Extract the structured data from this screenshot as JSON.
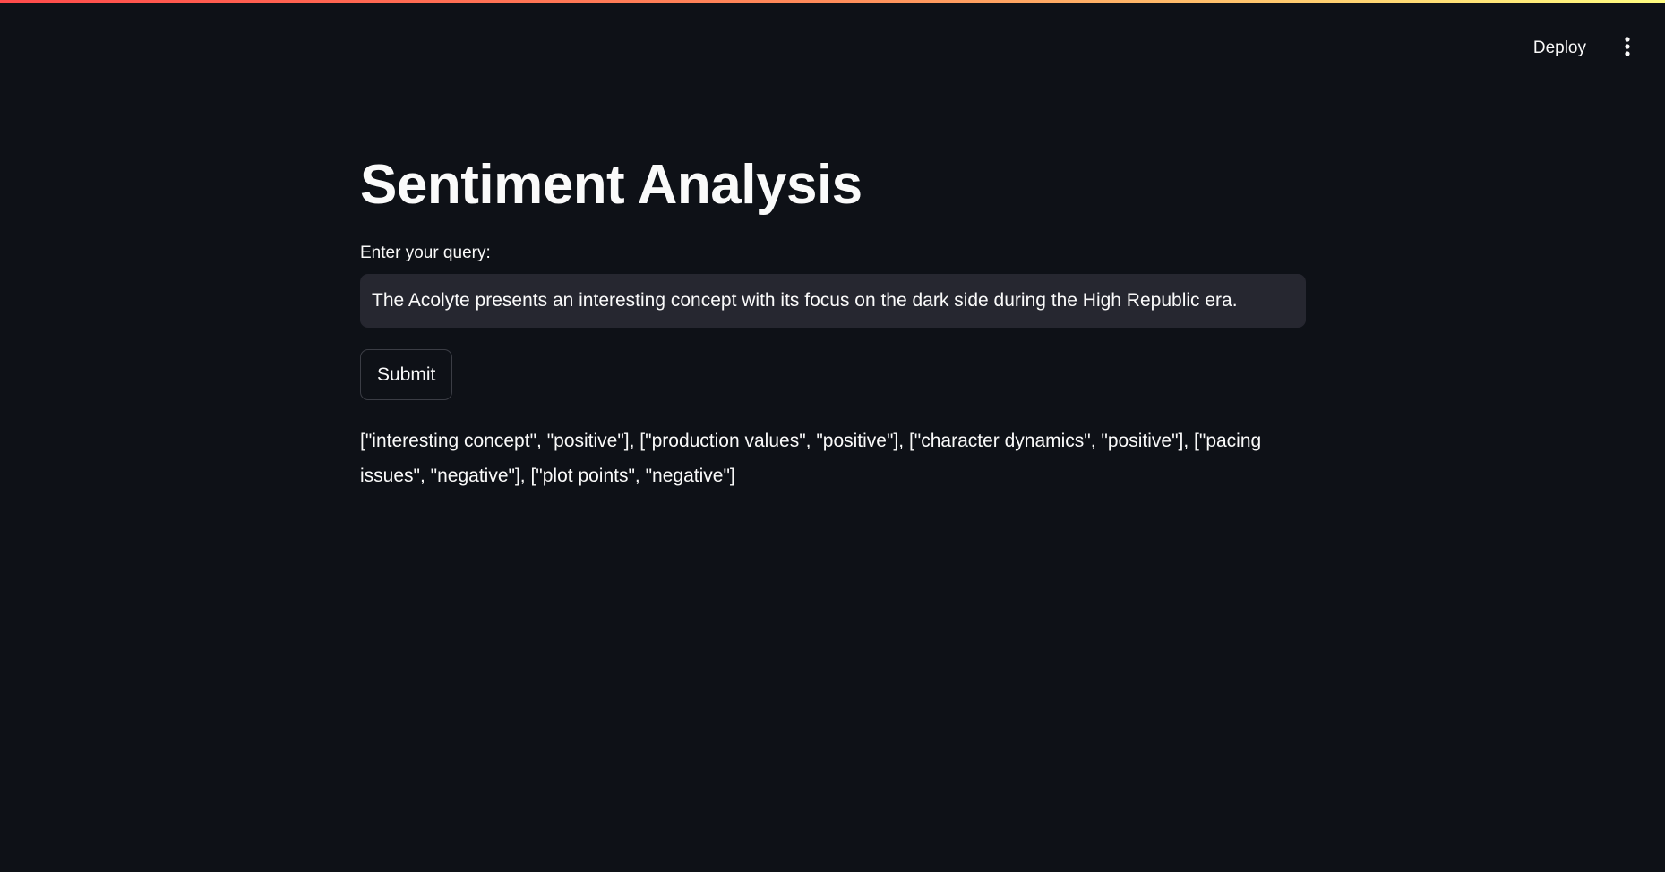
{
  "header": {
    "deploy_label": "Deploy",
    "menu_icon": "vertical-ellipsis-icon"
  },
  "main": {
    "title": "Sentiment Analysis",
    "query_label": "Enter your query:",
    "query_value": "The Acolyte presents an interesting concept with its focus on the dark side during the High Republic era.",
    "submit_label": "Submit",
    "result": "[\"interesting concept\", \"positive\"], [\"production values\", \"positive\"], [\"character dynamics\", \"positive\"], [\"pacing issues\", \"negative\"], [\"plot points\", \"negative\"]"
  },
  "colors": {
    "background": "#0e1117",
    "text": "#fafafa",
    "input_bg": "#262730",
    "accent_gradient_start": "#ff4b4b",
    "accent_gradient_end": "#fffd80"
  }
}
